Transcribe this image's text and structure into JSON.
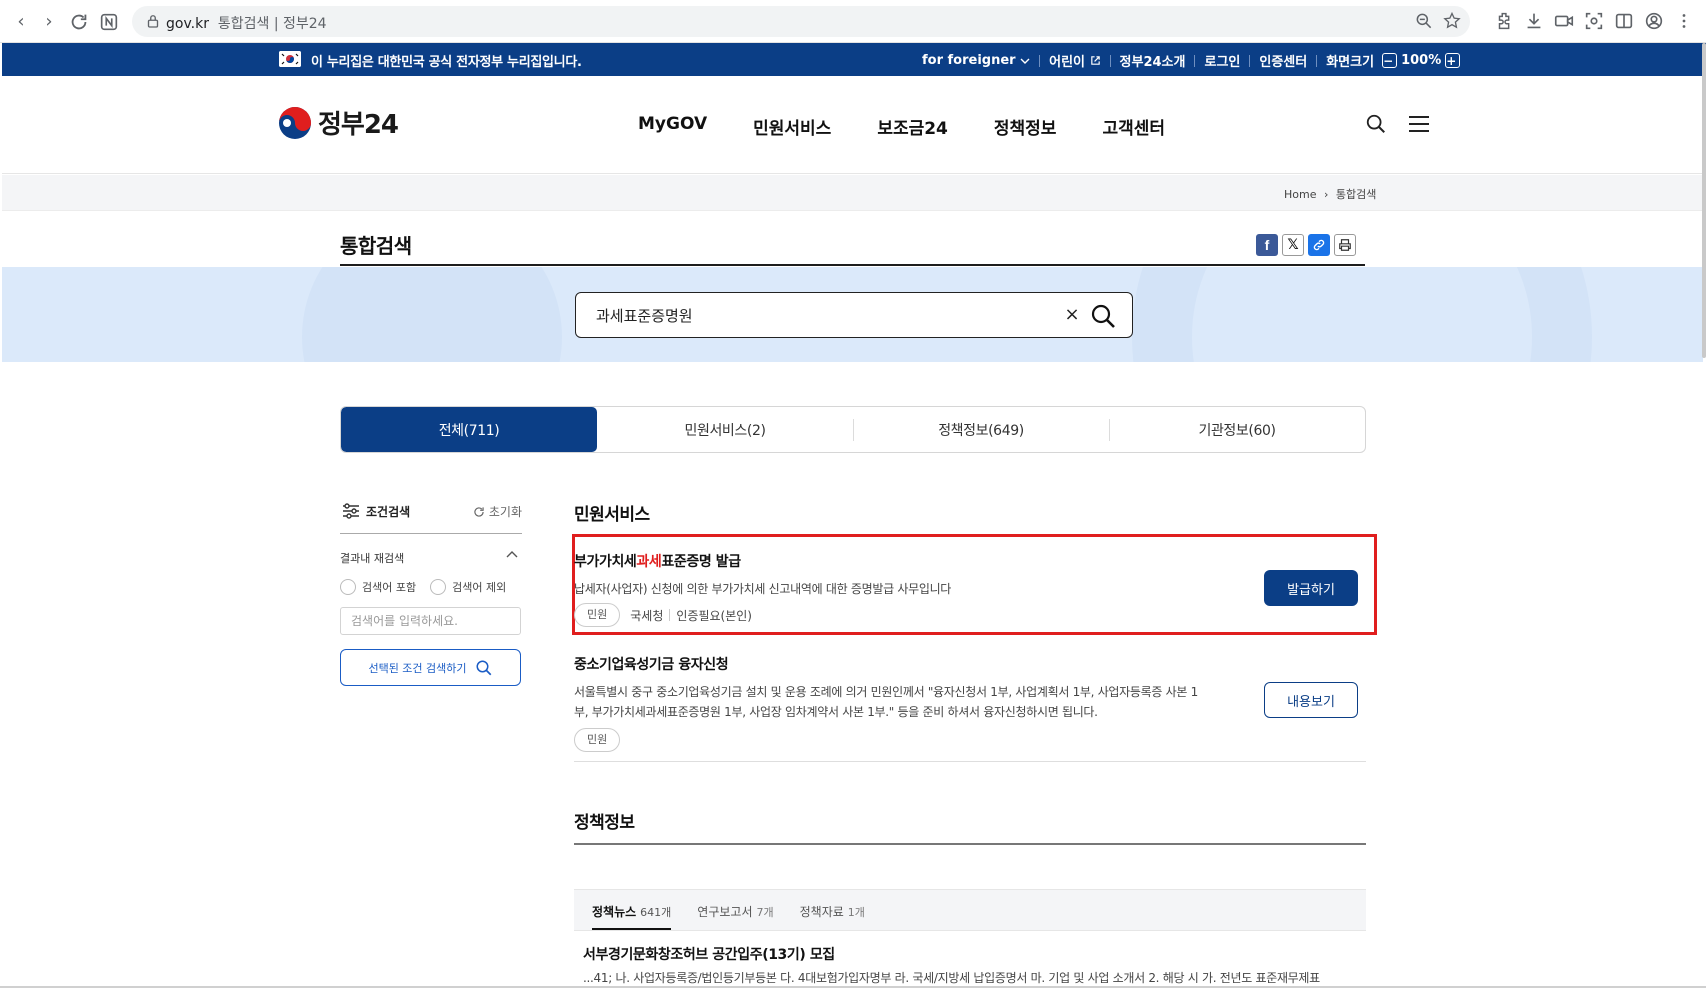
{
  "browser": {
    "url_domain": "gov.kr",
    "url_title": "통합검색 | 정부24"
  },
  "govbar": {
    "notice": "이 누리집은 대한민국 공식 전자정부 누리집입니다.",
    "links": [
      "for foreigner",
      "어린이",
      "정부24소개",
      "로그인",
      "인증센터",
      "화면크기"
    ],
    "zoom_level": "100%"
  },
  "header": {
    "logo_text": "정부24",
    "nav": [
      "MyGOV",
      "민원서비스",
      "보조금24",
      "정책정보",
      "고객센터"
    ]
  },
  "breadcrumb": [
    "Home",
    "통합검색"
  ],
  "page": {
    "title": "통합검색"
  },
  "search": {
    "query": "과세표준증명원",
    "clear_glyph": "×"
  },
  "tabs": [
    {
      "label": "전체(711)",
      "active": true
    },
    {
      "label": "민원서비스(2)",
      "active": false
    },
    {
      "label": "정책정보(649)",
      "active": false
    },
    {
      "label": "기관정보(60)",
      "active": false
    }
  ],
  "filter": {
    "title": "조건검색",
    "reset": "초기화",
    "within": "결과내 재검색",
    "include": "검색어 포함",
    "exclude": "검색어 제외",
    "placeholder": "검색어를 입력하세요.",
    "submit": "선택된 조건 검색하기"
  },
  "civil": {
    "section_title": "민원서비스",
    "items": [
      {
        "title_pre": "부가가치세",
        "title_hl": "과세",
        "title_post": "표준증명 발급",
        "desc": "납세자(사업자) 신청에 의한 부가가치세 신고내역에 대한 증명발급 사무입니다",
        "chip": "민원",
        "org": "국세청",
        "auth": "인증필요(본인)",
        "action": "발급하기"
      },
      {
        "title": "중소기업육성기금 융자신청",
        "desc1": "서울특별시 중구 중소기업육성기금 설치 및 운용 조례에 의거 민원인께서 \"융자신청서 1부, 사업계획서 1부, 사업자등록증 사본 1",
        "desc2": "부, 부가가치세과세표준증명원 1부, 사업장 임차계약서 사본 1부.\" 등을 준비 하셔서 융자신청하시면 됩니다.",
        "chip": "민원",
        "action": "내용보기"
      }
    ]
  },
  "policy": {
    "section_title": "정책정보",
    "subtabs": [
      {
        "label": "정책뉴스",
        "count": "641개",
        "active": true
      },
      {
        "label": "연구보고서",
        "count": "7개",
        "active": false
      },
      {
        "label": "정책자료",
        "count": "1개",
        "active": false
      }
    ],
    "news_title": "서부경기문화창조허브 공간입주(13기) 모집",
    "news_desc": "...41; 나. 사업자등록증/법인등기부등본 다. 4대보험가입자명부 라. 국세/지방세 납입증명서 마. 기업 및 사업 소개서 2. 해당 시 가. 전년도 표준재무제표"
  },
  "colors": {
    "brand_navy": "#0b3e86",
    "highlight_red": "#e01e1e",
    "banner_blue": "#dbe9fa"
  }
}
